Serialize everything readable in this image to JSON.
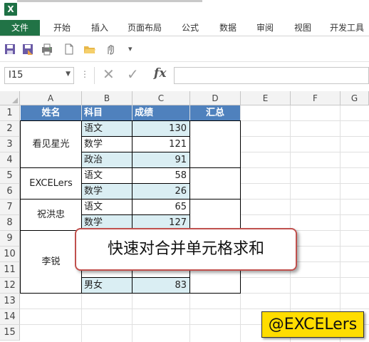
{
  "app": {
    "logo_letter": "X"
  },
  "ribbon": {
    "tabs": [
      "文件",
      "开始",
      "插入",
      "页面布局",
      "公式",
      "数据",
      "审阅",
      "视图",
      "开发工具"
    ]
  },
  "quick_access": {
    "icons": [
      "save-icon",
      "save-as-icon",
      "print-preview-icon",
      "new-document-icon",
      "open-folder-icon",
      "touch-mode-icon",
      "customize-dropdown-icon"
    ],
    "dropdown_glyph": "▾"
  },
  "formula_bar": {
    "name_box": "I15",
    "dots": "⋮",
    "cancel": "✕",
    "enter": "✓",
    "fx_label": "fx",
    "content": ""
  },
  "sheet": {
    "columns": [
      "A",
      "B",
      "C",
      "D",
      "E",
      "F",
      "G"
    ],
    "rows": [
      "1",
      "2",
      "3",
      "4",
      "5",
      "6",
      "7",
      "8",
      "9",
      "10",
      "11",
      "12",
      "13",
      "14",
      "15"
    ],
    "header": {
      "name": "姓名",
      "subject": "科目",
      "score": "成绩",
      "total": "汇总"
    },
    "names": [
      "看见星光",
      "EXCELers",
      "祝洪忠",
      "李锐"
    ],
    "subjects": [
      "语文",
      "数学",
      "政治",
      "语文",
      "数学",
      "语文",
      "数学",
      "",
      "",
      "",
      "男女"
    ],
    "scores": [
      "130",
      "121",
      "91",
      "58",
      "26",
      "65",
      "127",
      "",
      "",
      "",
      "83"
    ]
  },
  "callout": {
    "text": "快速对合并单元格求和"
  },
  "watermark": {
    "text": "@EXCELers"
  },
  "colors": {
    "header_fill": "#4f81bd",
    "band_fill": "#daeef3",
    "file_tab": "#217346",
    "callout_border": "#c0504d",
    "badge_fill": "#ffdd00"
  }
}
